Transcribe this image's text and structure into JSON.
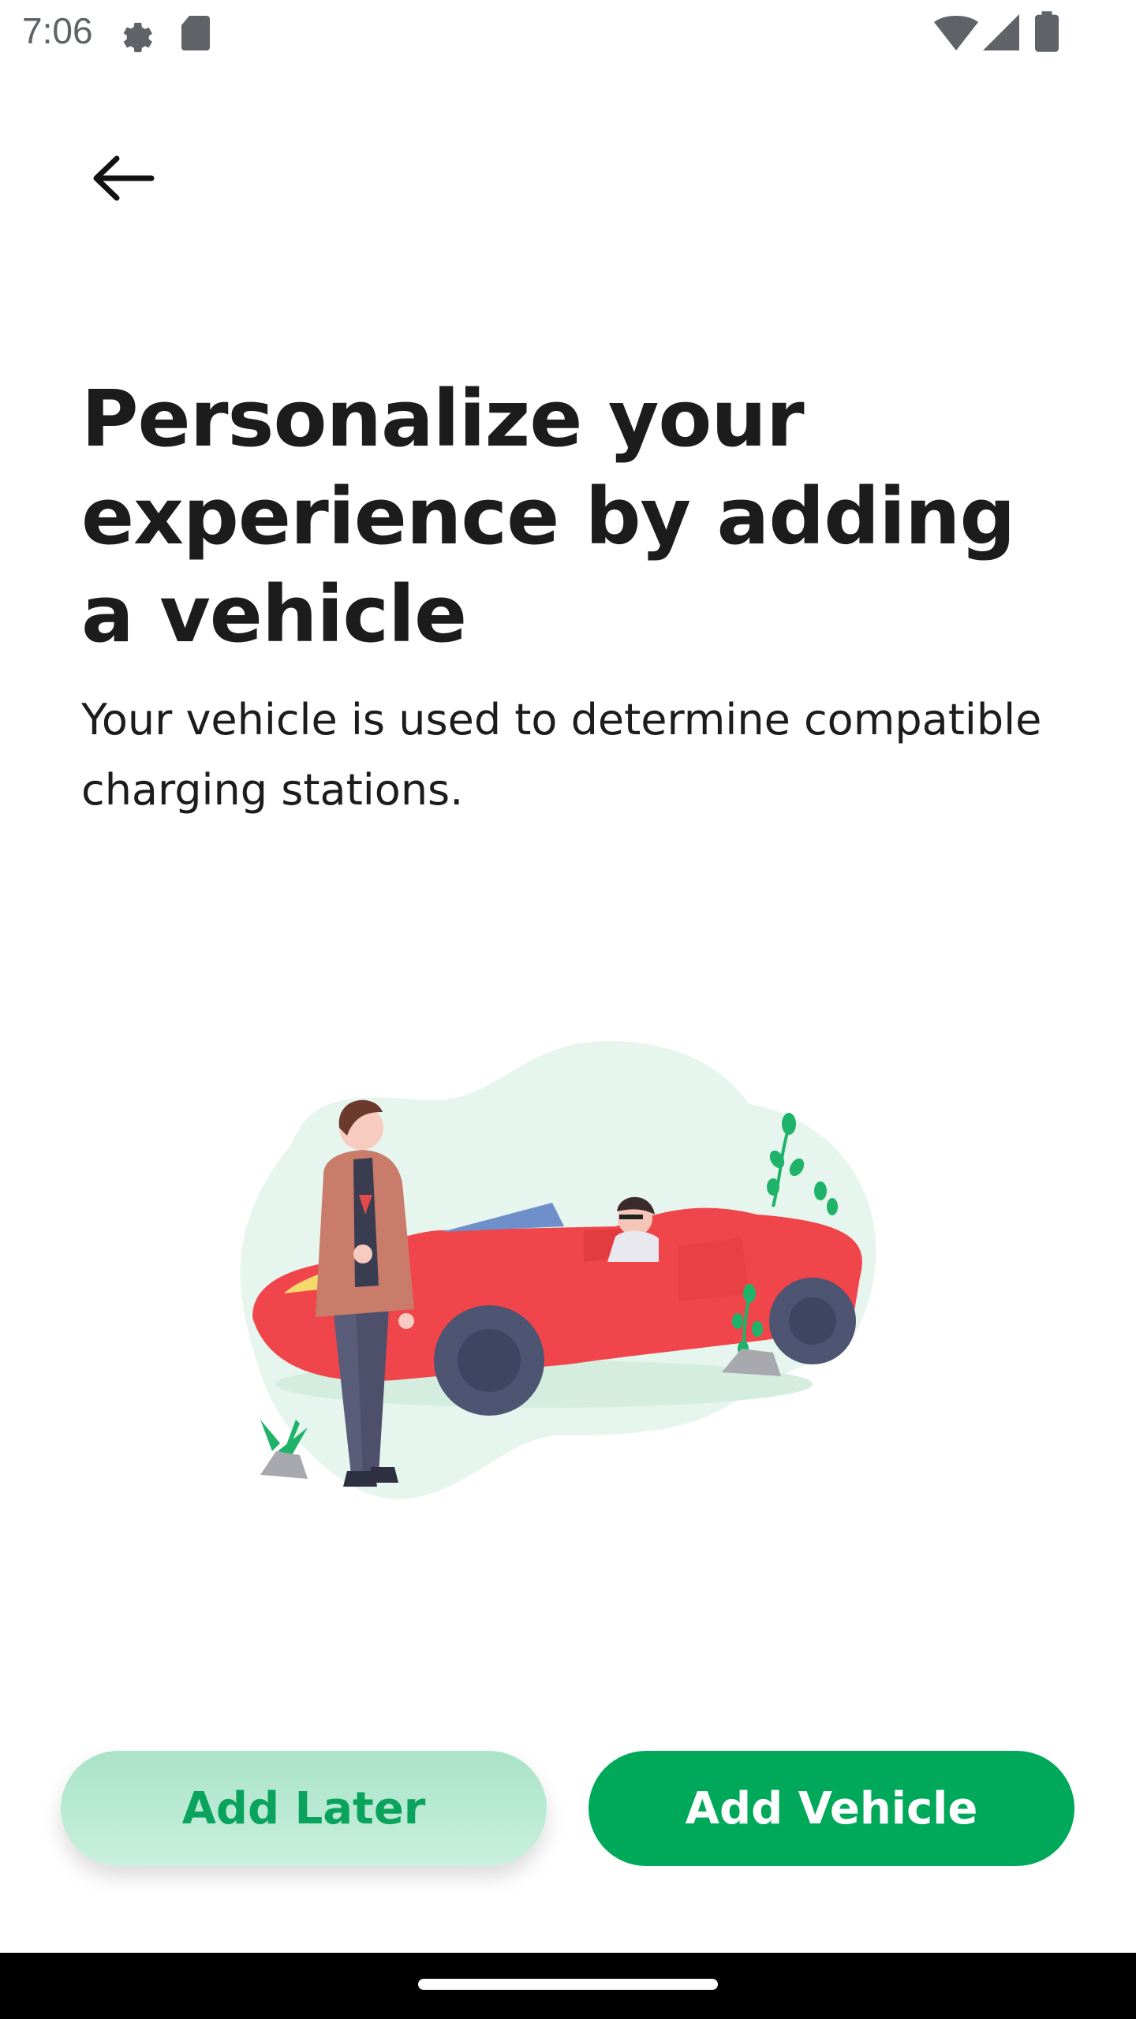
{
  "status_bar": {
    "time": "7:06",
    "icons": [
      "settings-gear-icon",
      "sd-card-icon",
      "wifi-icon",
      "cell-signal-icon",
      "battery-icon"
    ]
  },
  "toolbar": {
    "back_icon": "arrow-left-icon"
  },
  "content": {
    "title": "Personalize your experience by adding a vehicle",
    "subtitle": "Your vehicle is used to determine compatible charging stations."
  },
  "illustration": {
    "description_icon": "person-and-red-convertible-illustration"
  },
  "actions": {
    "add_later_label": "Add Later",
    "add_vehicle_label": "Add Vehicle"
  },
  "colors": {
    "primary": "#00a85a",
    "secondary_bg": "#b8ead2",
    "secondary_text": "#0aa35e",
    "car_red": "#f0454a",
    "blob": "#e6f5ee"
  }
}
